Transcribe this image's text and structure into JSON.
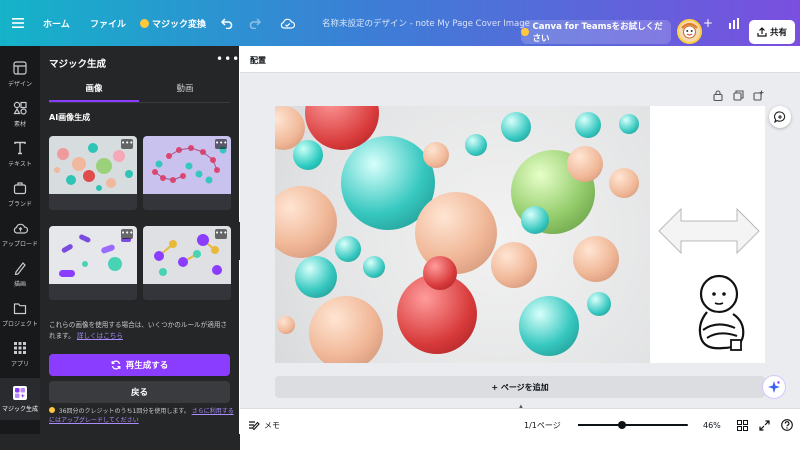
{
  "topbar": {
    "home": "ホーム",
    "file": "ファイル",
    "magic_switch": "マジック変換",
    "doc_title": "名称未設定のデザイン - note My Page Cover Image",
    "trial": "Canva for Teamsをお試しください",
    "share": "共有"
  },
  "rail": [
    {
      "label": "デザイン",
      "icon": "design-icon"
    },
    {
      "label": "素材",
      "icon": "elements-icon"
    },
    {
      "label": "テキスト",
      "icon": "text-icon"
    },
    {
      "label": "ブランド",
      "icon": "brand-icon"
    },
    {
      "label": "アップロード",
      "icon": "upload-icon"
    },
    {
      "label": "描画",
      "icon": "draw-icon"
    },
    {
      "label": "プロジェクト",
      "icon": "folder-icon"
    },
    {
      "label": "アプリ",
      "icon": "apps-icon"
    },
    {
      "label": "マジック生成",
      "icon": "magic-generate-icon"
    }
  ],
  "panel": {
    "title": "マジック生成",
    "tab_image": "画像",
    "tab_video": "動画",
    "section": "AI画像生成",
    "notice": "これらの画像を使用する場合は、いくつかのルールが適用されます。",
    "notice_link": "詳しくはこちら",
    "regenerate": "再生成する",
    "back": "戻る",
    "credit_text": "36回分のクレジットのうち1回分を使用します。",
    "credit_link": "さらに利用するにはアップグレードしてください"
  },
  "workspace": {
    "position_label": "配置",
    "add_page": "+ ページを追加"
  },
  "bottombar": {
    "notes": "メモ",
    "pages": "1/1ページ",
    "zoom": "46%",
    "zoom_level": 0.4
  },
  "colors": {
    "accent": "#8b3dff",
    "panel_bg": "#252627",
    "rail_bg": "#18191b"
  }
}
